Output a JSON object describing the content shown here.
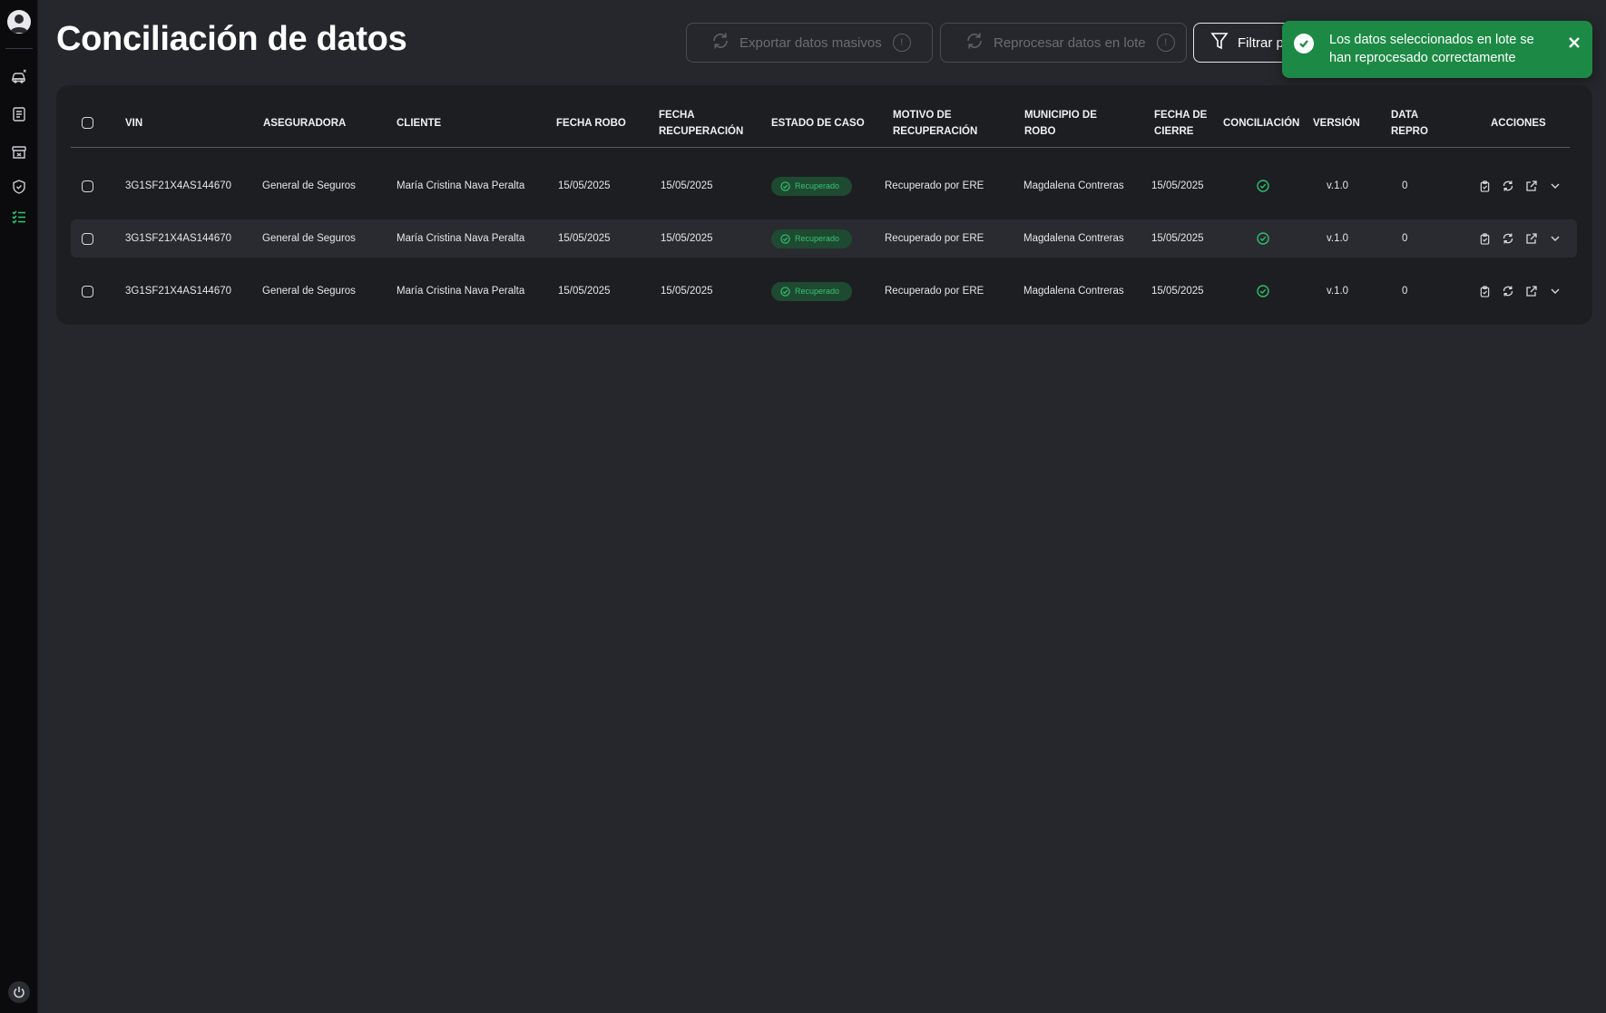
{
  "page": {
    "title": "Conciliación de datos"
  },
  "header": {
    "export_label": "Exportar datos masivos",
    "reprocess_label": "Reprocesar datos en lote",
    "filter_label": "Filtrar p",
    "info_glyph": "!"
  },
  "toast": {
    "message": "Los datos seleccionados en lote se han reprocesado correctamente",
    "close_glyph": "✕"
  },
  "sidebar": {
    "items": [
      "car-icon",
      "document-list-icon",
      "archive-box-icon",
      "shield-icon",
      "checklist-icon"
    ],
    "active_item": "checklist-icon"
  },
  "table": {
    "columns": {
      "vin": "VIN",
      "aseguradora": "ASEGURADORA",
      "cliente": "CLIENTE",
      "fecha_robo": "FECHA ROBO",
      "fecha_recuperacion_1": "FECHA",
      "fecha_recuperacion_2": "RECUPERACIÓN",
      "estado_caso": "ESTADO DE CASO",
      "motivo_1": "MOTIVO DE",
      "motivo_2": "RECUPERACIÓN",
      "municipio_1": "MUNICIPIO DE",
      "municipio_2": "ROBO",
      "fecha_cierre_1": "FECHA DE",
      "fecha_cierre_2": "CIERRE",
      "conciliacion": "CONCILIACIÓN",
      "version": "VERSIÓN",
      "data_repro_1": "DATA",
      "data_repro_2": "REPRO",
      "acciones": "ACCIONES"
    },
    "rows": [
      {
        "vin": "3G1SF21X4AS144670",
        "aseguradora": "General de Seguros",
        "cliente": "María Cristina Nava Peralta",
        "fecha_robo": "15/05/2025",
        "fecha_recuperacion": "15/05/2025",
        "estado": "Recuperado",
        "motivo": "Recuperado por ERE",
        "municipio": "Magdalena Contreras",
        "fecha_cierre": "15/05/2025",
        "version": "v.1.0",
        "data_repro": "0"
      },
      {
        "vin": "3G1SF21X4AS144670",
        "aseguradora": "General de Seguros",
        "cliente": "María Cristina Nava Peralta",
        "fecha_robo": "15/05/2025",
        "fecha_recuperacion": "15/05/2025",
        "estado": "Recuperado",
        "motivo": "Recuperado por ERE",
        "municipio": "Magdalena Contreras",
        "fecha_cierre": "15/05/2025",
        "version": "v.1.0",
        "data_repro": "0"
      },
      {
        "vin": "3G1SF21X4AS144670",
        "aseguradora": "General de Seguros",
        "cliente": "María Cristina Nava Peralta",
        "fecha_robo": "15/05/2025",
        "fecha_recuperacion": "15/05/2025",
        "estado": "Recuperado",
        "motivo": "Recuperado por ERE",
        "municipio": "Magdalena Contreras",
        "fecha_cierre": "15/05/2025",
        "version": "v.1.0",
        "data_repro": "0"
      }
    ]
  },
  "colors": {
    "success_green": "#1c8a45",
    "badge_bg": "#1e4a31",
    "badge_text": "#38c172",
    "accent_icon": "#2fbf71"
  }
}
